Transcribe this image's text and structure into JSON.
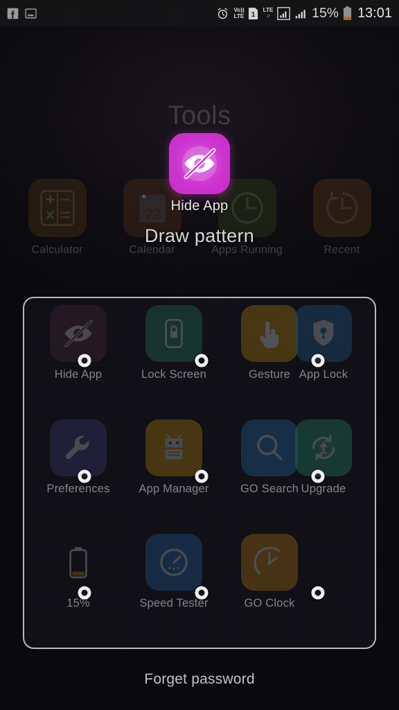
{
  "status_bar": {
    "left_icons": [
      {
        "name": "facebook-icon",
        "glyph": "f"
      },
      {
        "name": "gallery-icon",
        "glyph": "photo"
      }
    ],
    "right_icons": [
      {
        "name": "alarm-icon",
        "glyph": "alarm"
      },
      {
        "name": "volte-icon",
        "line1": "Vo))",
        "line2": "LTE"
      },
      {
        "name": "sim1-icon",
        "glyph": "1"
      },
      {
        "name": "lte-data-icon",
        "line1": "LTE",
        "line2": "↓↑"
      },
      {
        "name": "signal-sim1-icon",
        "glyph": "bars-boxed"
      },
      {
        "name": "signal-sim2-icon",
        "glyph": "bars"
      }
    ],
    "battery_percent": "15%",
    "clock": "13:01"
  },
  "launcher": {
    "folder_title": "Tools",
    "apps": [
      {
        "label": "Calculator",
        "icon": "calculator-icon",
        "color": "#4a3112"
      },
      {
        "label": "Calendar",
        "icon": "calendar-icon",
        "color": "#4c2b16"
      },
      {
        "label": "Apps Running",
        "icon": "clock-icon",
        "color": "#2b3d14"
      },
      {
        "label": "Recent",
        "icon": "history-clock-icon",
        "color": "#553414"
      }
    ]
  },
  "drag_item": {
    "label": "Hide App",
    "icon": "hidden-eye-icon",
    "color": "#cd33cf"
  },
  "prompt": {
    "draw_pattern": "Draw pattern",
    "forget_password": "Forget password"
  },
  "pattern_panel": {
    "border_color": "#b9b9bd",
    "rows": 3,
    "cols": 4,
    "dots": [
      {
        "row": 1,
        "col": 1,
        "state": "idle"
      },
      {
        "row": 1,
        "col": 2,
        "state": "idle"
      },
      {
        "row": 1,
        "col": 3,
        "state": "idle"
      },
      {
        "row": 2,
        "col": 1,
        "state": "idle"
      },
      {
        "row": 2,
        "col": 2,
        "state": "idle"
      },
      {
        "row": 2,
        "col": 3,
        "state": "idle"
      },
      {
        "row": 3,
        "col": 1,
        "state": "idle"
      },
      {
        "row": 3,
        "col": 2,
        "state": "idle"
      },
      {
        "row": 3,
        "col": 3,
        "state": "idle"
      }
    ],
    "apps": [
      {
        "label": "Hide App",
        "icon": "hidden-eye-icon",
        "color": "#3a2230"
      },
      {
        "label": "Lock Screen",
        "icon": "phone-lock-icon",
        "color": "#1e5d4c"
      },
      {
        "label": "Gesture",
        "icon": "pointing-hand-icon",
        "color": "#8a6410"
      },
      {
        "label": "App Lock",
        "icon": "shield-key-icon",
        "color": "#1d4a70"
      },
      {
        "label": "Preferences",
        "icon": "wrench-icon",
        "color": "#32305e"
      },
      {
        "label": "App Manager",
        "icon": "android-robot-icon",
        "color": "#8a630f"
      },
      {
        "label": "GO Search",
        "icon": "magnifier-icon",
        "color": "#1d5380"
      },
      {
        "label": "Upgrade",
        "icon": "upgrade-arrow-icon",
        "color": "#1e6a55"
      },
      {
        "label": "15%",
        "icon": "battery-icon",
        "color": "transparent"
      },
      {
        "label": "Speed Tester",
        "icon": "speedometer-icon",
        "color": "#1d4a78"
      },
      {
        "label": "GO Clock",
        "icon": "analog-clock-icon",
        "color": "#8a5c12"
      },
      {
        "label": "",
        "icon": "empty-slot",
        "color": "transparent"
      }
    ]
  }
}
